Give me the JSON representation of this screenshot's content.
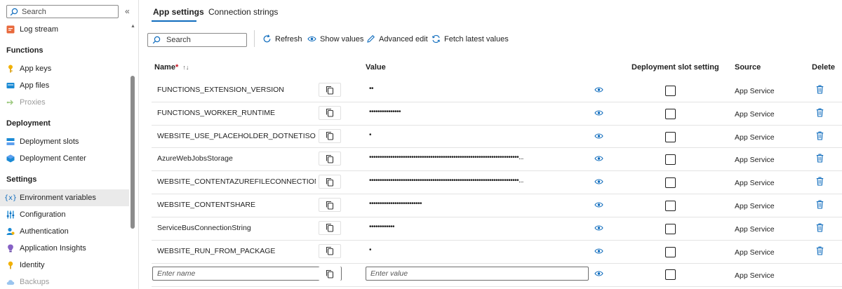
{
  "sidebar": {
    "search_placeholder": "Search",
    "collapse_glyph": "«",
    "items": [
      {
        "label": "Log stream",
        "icon": "log-stream-icon",
        "section": null
      },
      {
        "label": "App keys",
        "icon": "key-icon"
      },
      {
        "label": "App files",
        "icon": "app-files-icon"
      },
      {
        "label": "Proxies",
        "icon": "proxies-icon",
        "disabled": true
      },
      {
        "label": "Deployment slots",
        "icon": "deployment-slots-icon"
      },
      {
        "label": "Deployment Center",
        "icon": "deployment-center-icon"
      },
      {
        "label": "Environment variables",
        "icon": "environment-variables-icon",
        "active": true
      },
      {
        "label": "Configuration",
        "icon": "configuration-icon"
      },
      {
        "label": "Authentication",
        "icon": "authentication-icon"
      },
      {
        "label": "Application Insights",
        "icon": "application-insights-icon"
      },
      {
        "label": "Identity",
        "icon": "identity-icon"
      },
      {
        "label": "Backups",
        "icon": "backups-icon",
        "disabled": true
      }
    ],
    "sections": [
      "Functions",
      "Deployment",
      "Settings"
    ]
  },
  "tabs": [
    "App settings",
    "Connection strings"
  ],
  "toolbar": {
    "search_placeholder": "Search",
    "refresh": "Refresh",
    "show_values": "Show values",
    "advanced_edit": "Advanced edit",
    "fetch_latest": "Fetch latest values"
  },
  "table": {
    "headers": {
      "name": "Name",
      "required_mark": "*",
      "sort_glyph": "↑↓",
      "value": "Value",
      "slot": "Deployment slot setting",
      "source": "Source",
      "delete": "Delete"
    },
    "rows": [
      {
        "name": "FUNCTIONS_EXTENSION_VERSION",
        "value": "••",
        "source": "App Service"
      },
      {
        "name": "FUNCTIONS_WORKER_RUNTIME",
        "value": "•••••••••••••••",
        "source": "App Service"
      },
      {
        "name": "WEBSITE_USE_PLACEHOLDER_DOTNETISOLATED",
        "value": "•",
        "source": "App Service"
      },
      {
        "name": "AzureWebJobsStorage",
        "value": "•••••••••••••••••••••••••••••••••••••••••••••••••••••••••••••••••••••••...",
        "source": "App Service"
      },
      {
        "name": "WEBSITE_CONTENTAZUREFILECONNECTIONSTRI...",
        "value": "•••••••••••••••••••••••••••••••••••••••••••••••••••••••••••••••••••••••...",
        "source": "App Service"
      },
      {
        "name": "WEBSITE_CONTENTSHARE",
        "value": "•••••••••••••••••••••••••",
        "source": "App Service"
      },
      {
        "name": "ServiceBusConnectionString",
        "value": "••••••••••••",
        "source": "App Service"
      },
      {
        "name": "WEBSITE_RUN_FROM_PACKAGE",
        "value": "•",
        "source": "App Service"
      }
    ],
    "new_row": {
      "name_placeholder": "Enter name",
      "value_placeholder": "Enter value",
      "source": "App Service"
    }
  },
  "colors": {
    "accent": "#0f6cbd",
    "active_bg": "#eaeaea"
  }
}
